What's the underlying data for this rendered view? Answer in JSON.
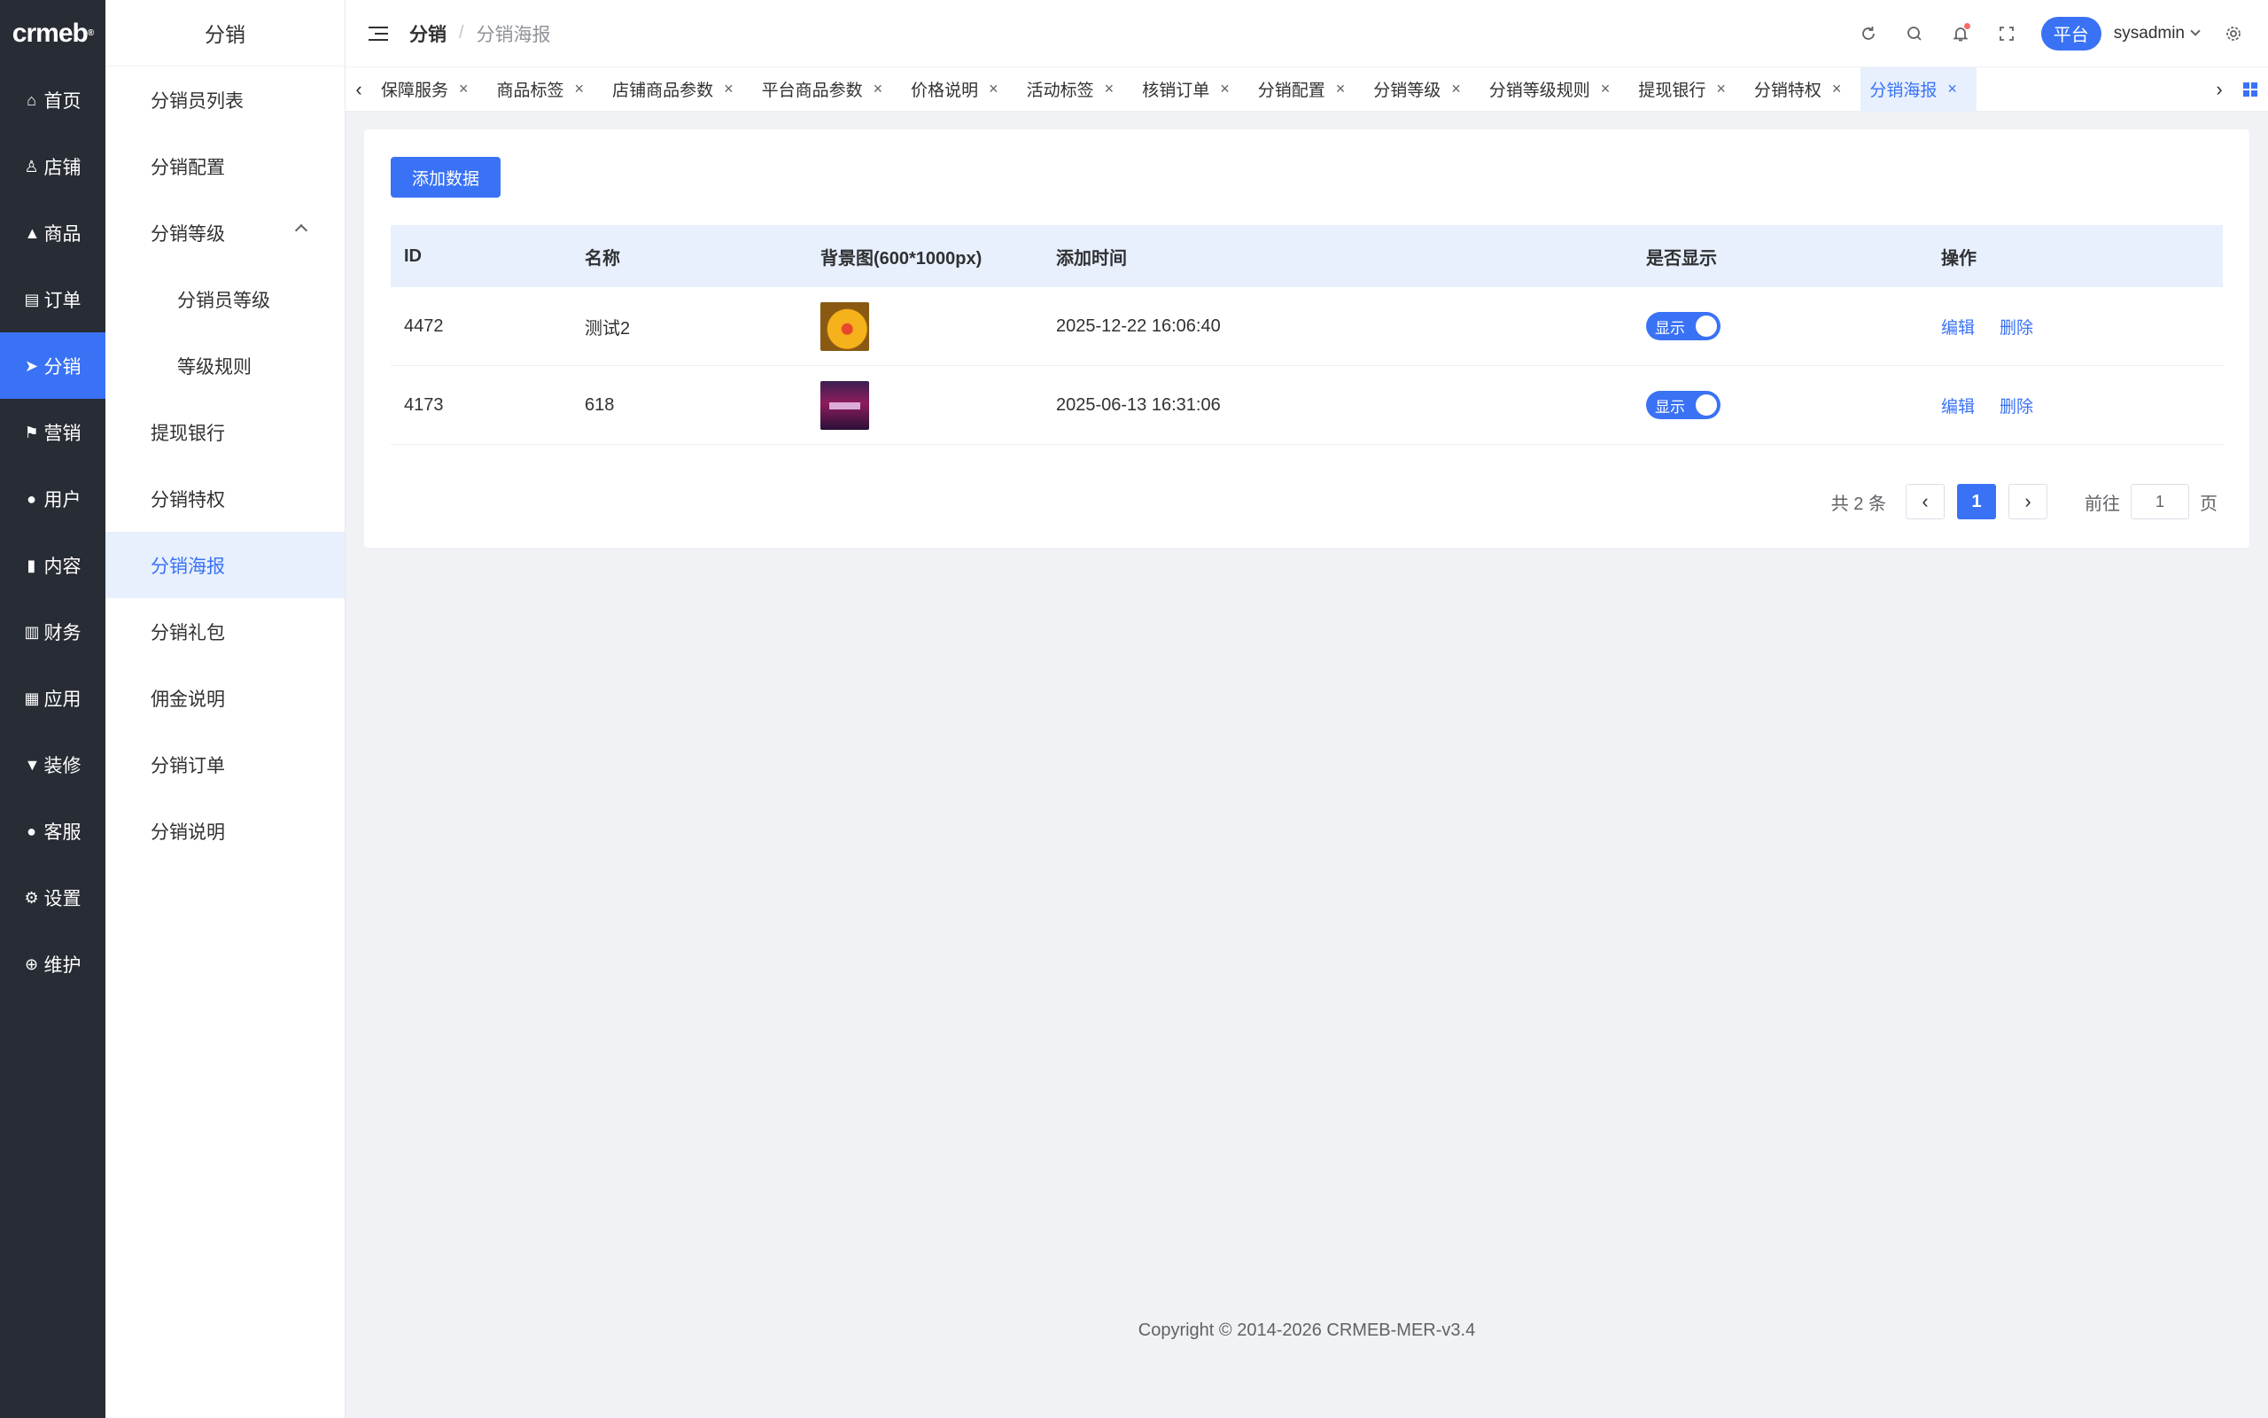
{
  "logo": {
    "text": "crmeb",
    "mark": "®"
  },
  "rail": [
    {
      "label": "首页",
      "icon": "home-icon",
      "glyph": "⌂"
    },
    {
      "label": "店铺",
      "icon": "store-icon",
      "glyph": "♙"
    },
    {
      "label": "商品",
      "icon": "goods-icon",
      "glyph": "▲"
    },
    {
      "label": "订单",
      "icon": "order-icon",
      "glyph": "▤"
    },
    {
      "label": "分销",
      "icon": "distribution-icon",
      "glyph": "➤",
      "active": true
    },
    {
      "label": "营销",
      "icon": "marketing-icon",
      "glyph": "⚑"
    },
    {
      "label": "用户",
      "icon": "user-icon",
      "glyph": "●"
    },
    {
      "label": "内容",
      "icon": "content-icon",
      "glyph": "▮"
    },
    {
      "label": "财务",
      "icon": "finance-icon",
      "glyph": "▥"
    },
    {
      "label": "应用",
      "icon": "apps-icon",
      "glyph": "▦"
    },
    {
      "label": "装修",
      "icon": "decorate-icon",
      "glyph": "▼"
    },
    {
      "label": "客服",
      "icon": "service-icon",
      "glyph": "●"
    },
    {
      "label": "设置",
      "icon": "settings-icon",
      "glyph": "⚙"
    },
    {
      "label": "维护",
      "icon": "maintenance-icon",
      "glyph": "⊕"
    }
  ],
  "sidebar": {
    "title": "分销",
    "items": [
      {
        "label": "分销员列表"
      },
      {
        "label": "分销配置"
      },
      {
        "label": "分销等级",
        "expanded": true
      },
      {
        "label": "分销员等级",
        "child": true
      },
      {
        "label": "等级规则",
        "child": true
      },
      {
        "label": "提现银行"
      },
      {
        "label": "分销特权"
      },
      {
        "label": "分销海报",
        "active": true
      },
      {
        "label": "分销礼包"
      },
      {
        "label": "佣金说明"
      },
      {
        "label": "分销订单"
      },
      {
        "label": "分销说明"
      }
    ]
  },
  "header": {
    "breadcrumb_main": "分销",
    "breadcrumb_sep": "/",
    "breadcrumb_sub": "分销海报",
    "platform": "平台",
    "username": "sysadmin"
  },
  "tabs": [
    {
      "label": "保障服务"
    },
    {
      "label": "商品标签"
    },
    {
      "label": "店铺商品参数"
    },
    {
      "label": "平台商品参数"
    },
    {
      "label": "价格说明"
    },
    {
      "label": "活动标签"
    },
    {
      "label": "核销订单"
    },
    {
      "label": "分销配置"
    },
    {
      "label": "分销等级"
    },
    {
      "label": "分销等级规则"
    },
    {
      "label": "提现银行"
    },
    {
      "label": "分销特权"
    },
    {
      "label": "分销海报",
      "active": true
    }
  ],
  "main": {
    "add_button": "添加数据",
    "columns": [
      "ID",
      "名称",
      "背景图(600*1000px)",
      "添加时间",
      "是否显示",
      "操作"
    ],
    "rows": [
      {
        "id": "4472",
        "name": "测试2",
        "thumb": "thumb-a",
        "time": "2025-12-22 16:06:40",
        "status": "显示",
        "edit": "编辑",
        "delete": "删除"
      },
      {
        "id": "4173",
        "name": "618",
        "thumb": "thumb-b",
        "time": "2025-06-13 16:31:06",
        "status": "显示",
        "edit": "编辑",
        "delete": "删除"
      }
    ],
    "pagination": {
      "total": "共 2 条",
      "current": "1",
      "goto_prefix": "前往",
      "goto_value": "1",
      "goto_suffix": "页"
    }
  },
  "footer": {
    "copyright": "Copyright © 2014-2026 CRMEB-MER-v3.4"
  },
  "colors": {
    "accent": "#3a72f5",
    "rail_bg": "#282c34",
    "page_bg": "#f0f2f5"
  }
}
